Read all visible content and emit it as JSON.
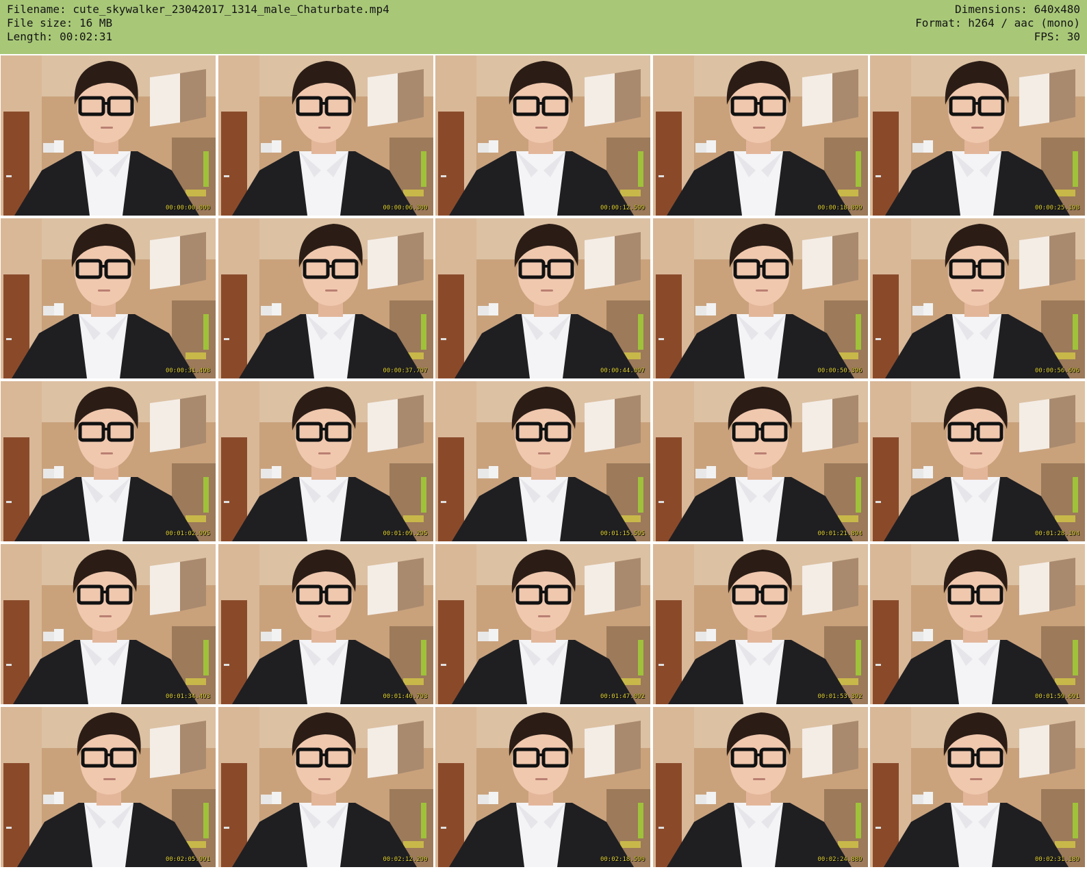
{
  "header": {
    "filename": "Filename: cute_skywalker_23042017_1314_male_Chaturbate.mp4",
    "filesize": "File size: 16 MB",
    "length": "Length: 00:02:31",
    "dimensions": "Dimensions: 640x480",
    "format": "Format: h264 / aac (mono)",
    "fps": "FPS: 30"
  },
  "thumbnails": [
    {
      "timestamp": "00:00:00.000"
    },
    {
      "timestamp": "00:00:06.300"
    },
    {
      "timestamp": "00:00:12.599"
    },
    {
      "timestamp": "00:00:18.899"
    },
    {
      "timestamp": "00:00:25.198"
    },
    {
      "timestamp": "00:00:31.498"
    },
    {
      "timestamp": "00:00:37.797"
    },
    {
      "timestamp": "00:00:44.097"
    },
    {
      "timestamp": "00:00:50.396"
    },
    {
      "timestamp": "00:00:56.696"
    },
    {
      "timestamp": "00:01:02.995"
    },
    {
      "timestamp": "00:01:09.295"
    },
    {
      "timestamp": "00:01:15.595"
    },
    {
      "timestamp": "00:01:21.894"
    },
    {
      "timestamp": "00:01:28.194"
    },
    {
      "timestamp": "00:01:34.493"
    },
    {
      "timestamp": "00:01:40.793"
    },
    {
      "timestamp": "00:01:47.092"
    },
    {
      "timestamp": "00:01:53.392"
    },
    {
      "timestamp": "00:01:59.691"
    },
    {
      "timestamp": "00:02:05.991"
    },
    {
      "timestamp": "00:02:12.290"
    },
    {
      "timestamp": "00:02:18.590"
    },
    {
      "timestamp": "00:02:24.889"
    },
    {
      "timestamp": "00:02:31.189"
    }
  ],
  "colors": {
    "header_bg": "#a8c878",
    "timestamp": "#e8d83a"
  }
}
